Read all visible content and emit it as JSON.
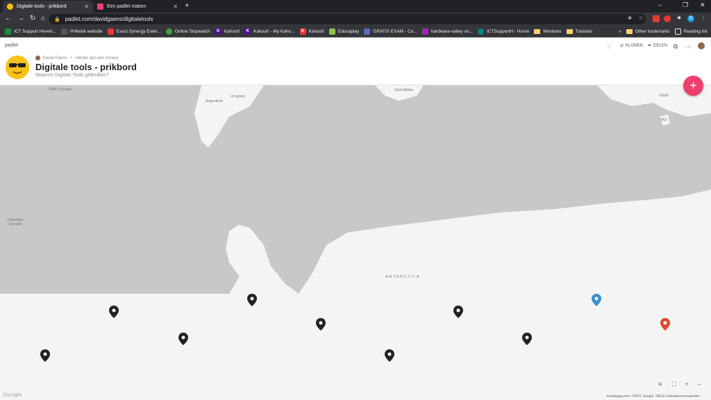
{
  "tabs": [
    {
      "title": "Digitale tools - prikbord",
      "active": true
    },
    {
      "title": "Een padlet maken",
      "active": false
    }
  ],
  "address": {
    "url": "padlet.com/davidgaens/digitaletools"
  },
  "window_controls": {
    "minimize": "–",
    "maximize": "❐",
    "close": "✕"
  },
  "bookmarks": [
    {
      "label": "ICT Support Heverl...",
      "icon_color": "#1e8e3e"
    },
    {
      "label": "Prikklok website",
      "icon_color": "#555"
    },
    {
      "label": "Exact Synergy Enter...",
      "icon_color": "#e53935"
    },
    {
      "label": "Online Stopwatch",
      "icon_color": "#43a047"
    },
    {
      "label": "Kahoot!",
      "icon_color": "#46178f"
    },
    {
      "label": "Kahoot! - My Kaho...",
      "icon_color": "#46178f"
    },
    {
      "label": "Kahoot!",
      "icon_color": "#e53935"
    },
    {
      "label": "Educaplay",
      "icon_color": "#8bc34a"
    },
    {
      "label": "GRATIS EXAM - Co...",
      "icon_color": "#5c6bc0"
    },
    {
      "label": "hardware-valley on...",
      "icon_color": "#9c27b0"
    },
    {
      "label": "ICTSupportH - Home",
      "icon_color": "#00897b"
    },
    {
      "label": "Windows",
      "folder": true
    },
    {
      "label": "Tutorials",
      "folder": true
    }
  ],
  "bookmarks_right": {
    "more": "»",
    "other": "Other bookmarks",
    "reading": "Reading list"
  },
  "padlet": {
    "logo": "padlet",
    "author": "David Gaens",
    "time": "minder dan een minuut",
    "title": "Digitale tools - prikbord",
    "subtitle": "Waarom Digitale Tools gebruiken?",
    "actions": {
      "clone": "KLONEN",
      "share": "DELEN"
    },
    "fab": "+"
  },
  "map": {
    "labels": {
      "antarctica": "ANTARCTICA",
      "argentinie": "Argentinië",
      "uruguay": "Uruguay",
      "zuid_afrika": "Zuid-Afrika",
      "stille_oceaan": "Stille Oceaan",
      "zuidelijke_oceaan": "Zuidelijke Oceaan",
      "nsw": "NSW",
      "tas": "TAS"
    },
    "pins": [
      {
        "color": "#222"
      },
      {
        "color": "#222"
      },
      {
        "color": "#222"
      },
      {
        "color": "#222"
      },
      {
        "color": "#222"
      },
      {
        "color": "#222"
      },
      {
        "color": "#222"
      },
      {
        "color": "#222"
      },
      {
        "color": "#3a8fd1"
      },
      {
        "color": "#e0492b"
      }
    ],
    "controls": {
      "list": "≡",
      "fullscreen": "⛶",
      "zoom_in": "+",
      "zoom_out": "–"
    },
    "attribution": "Kaartgegevens ©2021 Google, INEGI   Gebruiksvoorwaarden",
    "google": "Google"
  }
}
